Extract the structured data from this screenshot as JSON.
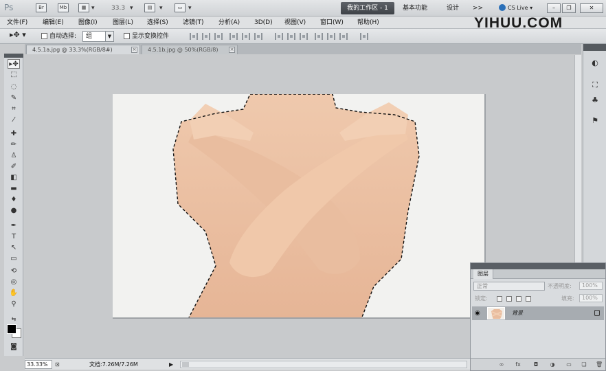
{
  "appbar": {
    "logo": "Ps",
    "br_label": "Br",
    "mb_label": "Mb",
    "zoom": "33.3",
    "workspace_active": "我的工作区 - 1",
    "workspace_basic": "基本功能",
    "workspace_design": "设计",
    "more": ">>",
    "cs_live": "CS Live"
  },
  "menubar": {
    "items": [
      "文件(F)",
      "编辑(E)",
      "图像(I)",
      "图层(L)",
      "选择(S)",
      "滤镜(T)",
      "分析(A)",
      "3D(D)",
      "视图(V)",
      "窗口(W)",
      "帮助(H)"
    ]
  },
  "watermark": "YIHUU.COM",
  "options": {
    "auto_select_label": "自动选择:",
    "auto_select_value": "组",
    "transform_label": "显示变换控件"
  },
  "doc_tabs": [
    {
      "label": "4.5.1a.jpg @ 33.3%(RGB/8#)"
    },
    {
      "label": "4.5.1b.jpg @ 50%(RGB/8)"
    }
  ],
  "layers_panel": {
    "tab": "图层",
    "blend_mode": "正常",
    "opacity_label": "不透明度:",
    "opacity_value": "100%",
    "lock_label": "锁定:",
    "fill_label": "填充:",
    "fill_value": "100%",
    "layer_name": "背景"
  },
  "status": {
    "zoom": "33.33%",
    "doc_info": "文档:7.26M/7.26M"
  }
}
